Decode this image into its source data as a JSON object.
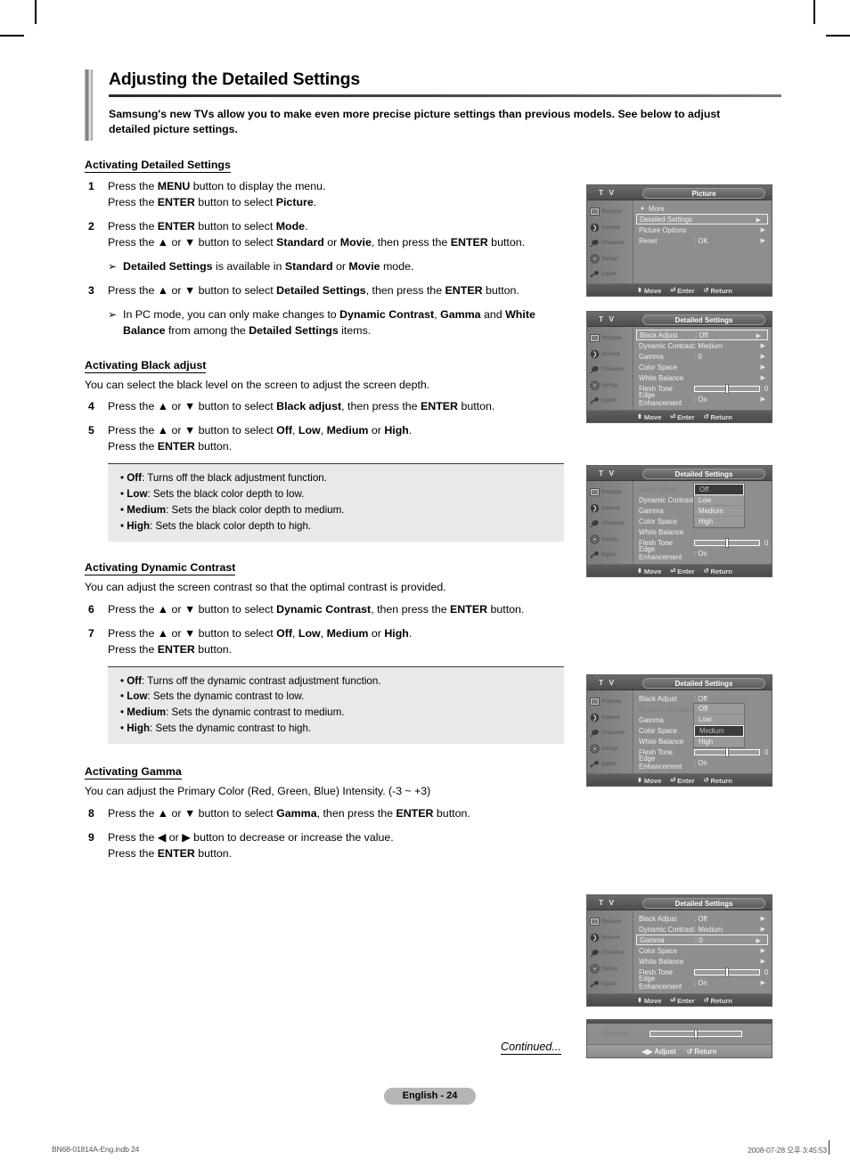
{
  "document": {
    "title": "Adjusting the Detailed Settings",
    "intro": "Samsung's new TVs allow you to make even more precise picture settings than previous models. See below to adjust detailed picture settings.",
    "continued_label": "Continued...",
    "page_badge": "English - 24",
    "footer_left": "BN68-01814A-Eng.indb   24",
    "footer_right": "2008-07-28   오후 3:45:53"
  },
  "sections": [
    {
      "heading": "Activating Detailed Settings",
      "description": "",
      "steps": [
        {
          "num": "1",
          "lines": [
            "Press the MENU button to display the menu.",
            "Press the ENTER button to select Picture."
          ]
        },
        {
          "num": "2",
          "lines": [
            "Press the ENTER button to select Mode.",
            "Press the ▲ or ▼ button to select Standard or Movie, then press the ENTER button."
          ]
        },
        {
          "num": "3",
          "lines": [
            "Press the ▲ or ▼ button to select Detailed Settings, then press the ENTER button."
          ]
        }
      ],
      "notes": [
        "Detailed Settings is available in Standard or Movie mode.",
        "In PC mode, you can only make changes to Dynamic Contrast, Gamma and White Balance from among the Detailed Settings items."
      ]
    },
    {
      "heading": "Activating Black adjust",
      "description": "You can select the black level on the screen to adjust the screen depth.",
      "steps": [
        {
          "num": "4",
          "lines": [
            "Press the ▲ or ▼ button to select Black adjust, then press the ENTER button."
          ]
        },
        {
          "num": "5",
          "lines": [
            "Press the ▲ or ▼ button to select Off, Low, Medium or High.",
            "Press the ENTER button."
          ]
        }
      ],
      "tips": [
        {
          "term": "Off",
          "text": ": Turns off the black adjustment function."
        },
        {
          "term": "Low",
          "text": ": Sets the black color depth to low."
        },
        {
          "term": "Medium",
          "text": ": Sets the black color depth to medium."
        },
        {
          "term": "High",
          "text": ": Sets the black color depth to high."
        }
      ]
    },
    {
      "heading": "Activating Dynamic Contrast",
      "description": "You can adjust the screen contrast so that the optimal contrast is provided.",
      "steps": [
        {
          "num": "6",
          "lines": [
            "Press the ▲ or ▼ button to select Dynamic Contrast, then press the ENTER button."
          ]
        },
        {
          "num": "7",
          "lines": [
            "Press the ▲ or ▼ button to select Off, Low, Medium or High.",
            "Press the ENTER button."
          ]
        }
      ],
      "tips": [
        {
          "term": "Off",
          "text": ": Turns off the dynamic contrast adjustment function."
        },
        {
          "term": "Low",
          "text": ": Sets the dynamic contrast to low."
        },
        {
          "term": "Medium",
          "text": ": Sets the dynamic contrast to medium."
        },
        {
          "term": "High",
          "text": ": Sets the dynamic contrast to high."
        }
      ]
    },
    {
      "heading": "Activating Gamma",
      "description": "You can adjust the Primary Color (Red, Green, Blue) Intensity. (-3 ~ +3)",
      "steps": [
        {
          "num": "8",
          "lines": [
            "Press the ▲ or ▼ button to select Gamma, then press the ENTER button."
          ]
        },
        {
          "num": "9",
          "lines": [
            "Press the ◀ or ▶ button to decrease or increase the value.",
            "Press the ENTER button."
          ]
        }
      ]
    }
  ],
  "osd": {
    "tv_label": "T V",
    "sidebar": [
      {
        "label": "Picture",
        "icon": "picture-icon"
      },
      {
        "label": "Sound",
        "icon": "sound-icon"
      },
      {
        "label": "Channel",
        "icon": "channel-icon"
      },
      {
        "label": "Setup",
        "icon": "setup-icon"
      },
      {
        "label": "Input",
        "icon": "input-icon"
      }
    ],
    "hints": {
      "move": "Move",
      "enter": "Enter",
      "return": "Return",
      "adjust": "Adjust"
    },
    "panels": [
      {
        "name": "picture-menu",
        "title": "Picture",
        "rows": [
          {
            "label": "More",
            "value": "",
            "more": true
          },
          {
            "label": "Detailed Settings",
            "value": "",
            "arrow": true,
            "selected": true
          },
          {
            "label": "Picture Options",
            "value": "",
            "arrow": true
          },
          {
            "label": "Reset",
            "value": ": OK",
            "arrow": true
          }
        ]
      },
      {
        "name": "detailed-settings-menu",
        "title": "Detailed Settings",
        "rows": [
          {
            "label": "Black Adjust",
            "value": ": Off",
            "arrow": true,
            "selected": true
          },
          {
            "label": "Dynamic Contrast",
            "value": ": Medium",
            "arrow": true
          },
          {
            "label": "Gamma",
            "value": ": 0",
            "arrow": true
          },
          {
            "label": "Color Space",
            "value": "",
            "arrow": true
          },
          {
            "label": "White Balance",
            "value": "",
            "arrow": true
          },
          {
            "label": "Flesh Tone",
            "value": "0",
            "slider": 50
          },
          {
            "label": "Edge Enhancement",
            "value": ": On",
            "arrow": true
          }
        ]
      },
      {
        "name": "black-adjust-dropdown",
        "title": "Detailed Settings",
        "rows": [
          {
            "label": "Black Adjust",
            "value": ":",
            "dim": true
          },
          {
            "label": "Dynamic Contrast",
            "value": ":"
          },
          {
            "label": "Gamma",
            "value": ":"
          },
          {
            "label": "Color Space",
            "value": ""
          },
          {
            "label": "White Balance",
            "value": ""
          },
          {
            "label": "Flesh Tone",
            "value": "0",
            "slider": 50
          },
          {
            "label": "Edge Enhancement",
            "value": ": On"
          }
        ],
        "dropdown": {
          "anchor_row": 0,
          "options": [
            "Off",
            "Low",
            "Medium",
            "High"
          ],
          "current": "Off",
          "highlighted": "Off"
        }
      },
      {
        "name": "dynamic-contrast-dropdown",
        "title": "Detailed Settings",
        "rows": [
          {
            "label": "Black Adjust",
            "value": ": Off"
          },
          {
            "label": "Dynamic Contrast",
            "value": ":",
            "dim": true
          },
          {
            "label": "Gamma",
            "value": ":"
          },
          {
            "label": "Color Space",
            "value": ""
          },
          {
            "label": "White Balance",
            "value": ""
          },
          {
            "label": "Flesh Tone",
            "value": "0",
            "slider": 50
          },
          {
            "label": "Edge Enhancement",
            "value": ": On"
          }
        ],
        "dropdown": {
          "anchor_row": 1,
          "options": [
            "Off",
            "Low",
            "Medium",
            "High"
          ],
          "current": "Medium",
          "highlighted": "Medium"
        }
      },
      {
        "name": "gamma-selected-menu",
        "title": "Detailed Settings",
        "rows": [
          {
            "label": "Black Adjust",
            "value": ": Off",
            "arrow": true
          },
          {
            "label": "Dynamic Contrast",
            "value": ": Medium",
            "arrow": true
          },
          {
            "label": "Gamma",
            "value": ": 0",
            "arrow": true,
            "selected": true
          },
          {
            "label": "Color Space",
            "value": "",
            "arrow": true
          },
          {
            "label": "White Balance",
            "value": "",
            "arrow": true
          },
          {
            "label": "Flesh Tone",
            "value": "0",
            "slider": 50
          },
          {
            "label": "Edge Enhancement",
            "value": ": On",
            "arrow": true
          }
        ]
      }
    ],
    "gamma_bar": {
      "label": "Gamma",
      "value": "0",
      "position": 50
    }
  }
}
